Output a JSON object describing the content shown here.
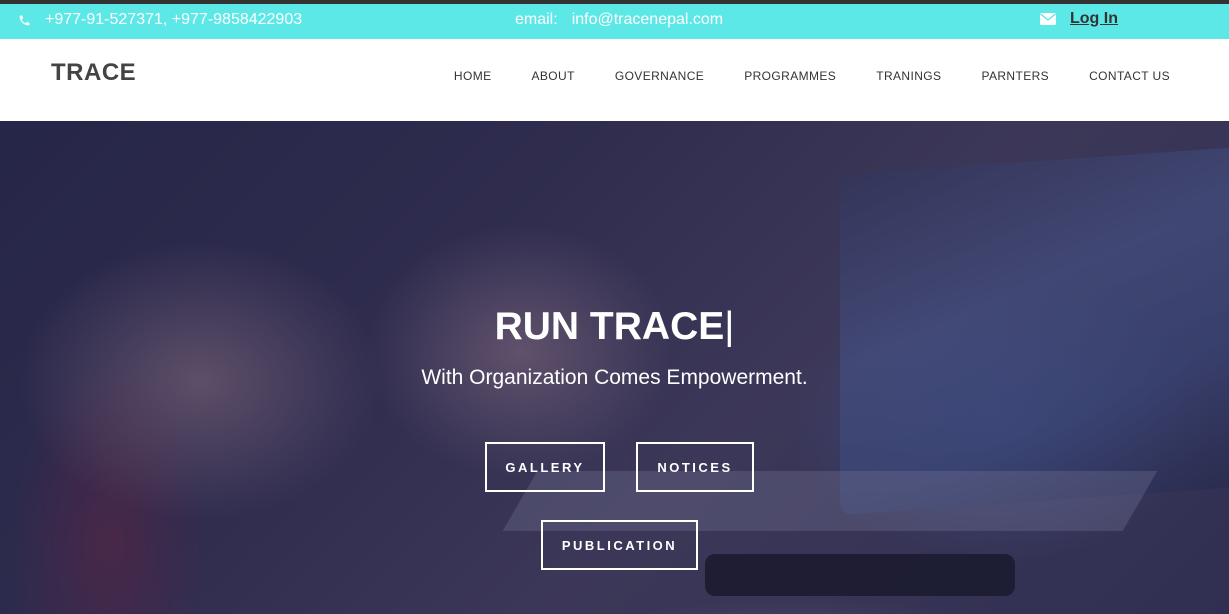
{
  "topbar": {
    "phone_icon": "phone-icon",
    "phone": "+977-91-527371, +977-9858422903",
    "email_label": "email:",
    "email_value": "info@tracenepal.com",
    "envelope_icon": "envelope-icon",
    "login": "Log In"
  },
  "navbar": {
    "brand": "TRACE",
    "items": [
      "HOME",
      "ABOUT",
      "GOVERNANCE",
      "PROGRAMMES",
      "TRANINGS",
      "PARNTERS",
      "CONTACT US"
    ]
  },
  "hero": {
    "title": "RUN TRACE",
    "cursor": "|",
    "subtitle": "With Organization Comes Empowerment.",
    "buttons": {
      "gallery": "GALLERY",
      "notices": "NOTICES",
      "publication": "PUBLICATION"
    }
  },
  "colors": {
    "topbar_bg": "#5de8e8",
    "overlay": "#1e1e46"
  }
}
